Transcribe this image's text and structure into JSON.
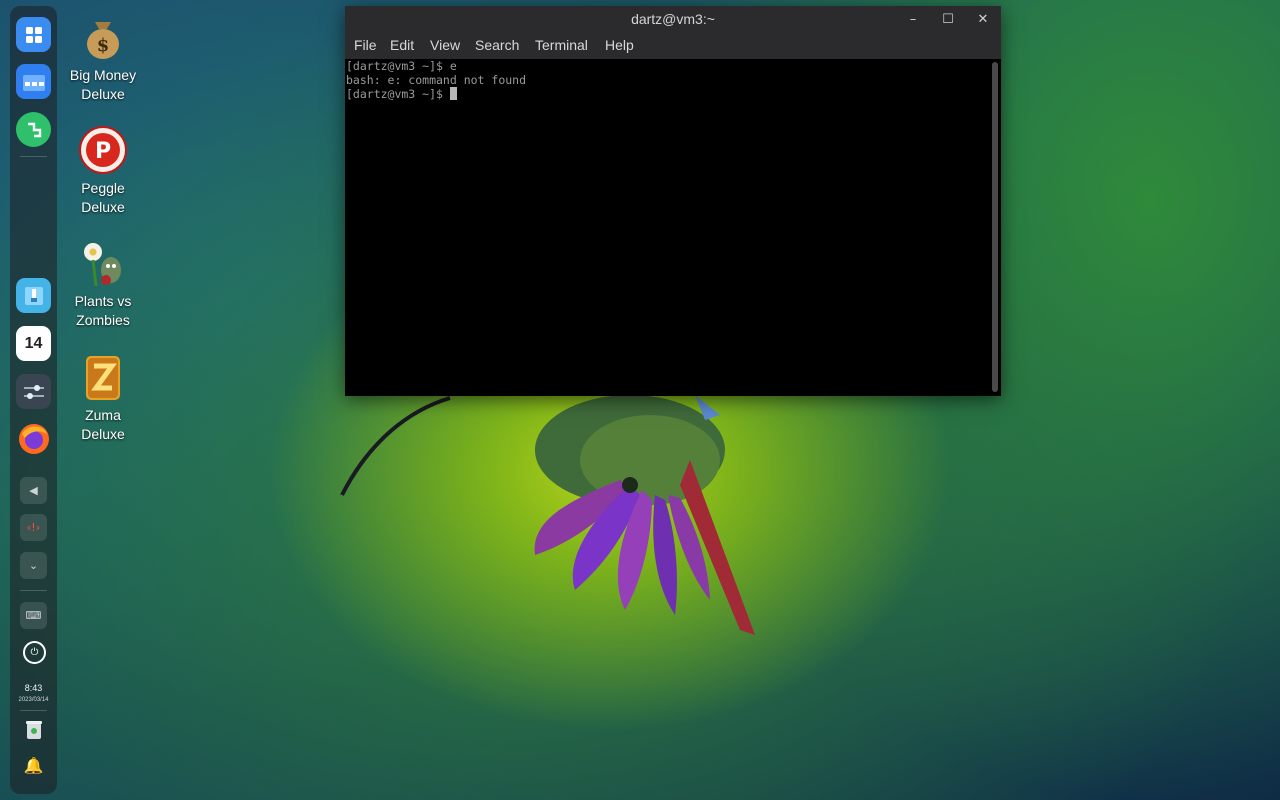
{
  "dock": {
    "items": [
      {
        "name": "app-launcher-icon",
        "color": "#3b8cf0"
      },
      {
        "name": "file-manager-icon",
        "color": "#2f7ff0"
      },
      {
        "name": "app-store-icon",
        "color": "#2ec06a"
      },
      {
        "name": "archive-icon",
        "color": "#43b3e8"
      },
      {
        "name": "calendar-icon",
        "color": "#ffffff"
      },
      {
        "name": "settings-icon",
        "color": "#3a4552"
      },
      {
        "name": "firefox-icon",
        "color": "#ff6a1e"
      }
    ],
    "calendar_day": "14",
    "clock_time": "8:43",
    "clock_date": "2023/03/14"
  },
  "desktop_icons": [
    {
      "label": "Big Money Deluxe",
      "line1": "Big Money",
      "line2": "Deluxe",
      "icon": "money-bag-icon"
    },
    {
      "label": "Peggle Deluxe",
      "line1": "Peggle",
      "line2": "Deluxe",
      "icon": "peggle-icon"
    },
    {
      "label": "Plants vs Zombies",
      "line1": "Plants vs",
      "line2": "Zombies",
      "icon": "plants-vs-zombies-icon"
    },
    {
      "label": "Zuma Deluxe",
      "line1": "Zuma",
      "line2": "Deluxe",
      "icon": "zuma-icon"
    }
  ],
  "terminal": {
    "title": "dartz@vm3:~",
    "menu": [
      "File",
      "Edit",
      "View",
      "Search",
      "Terminal",
      "Help"
    ],
    "lines": [
      "[dartz@vm3 ~]$ e",
      "bash: e: command not found",
      "[dartz@vm3 ~]$ "
    ]
  }
}
